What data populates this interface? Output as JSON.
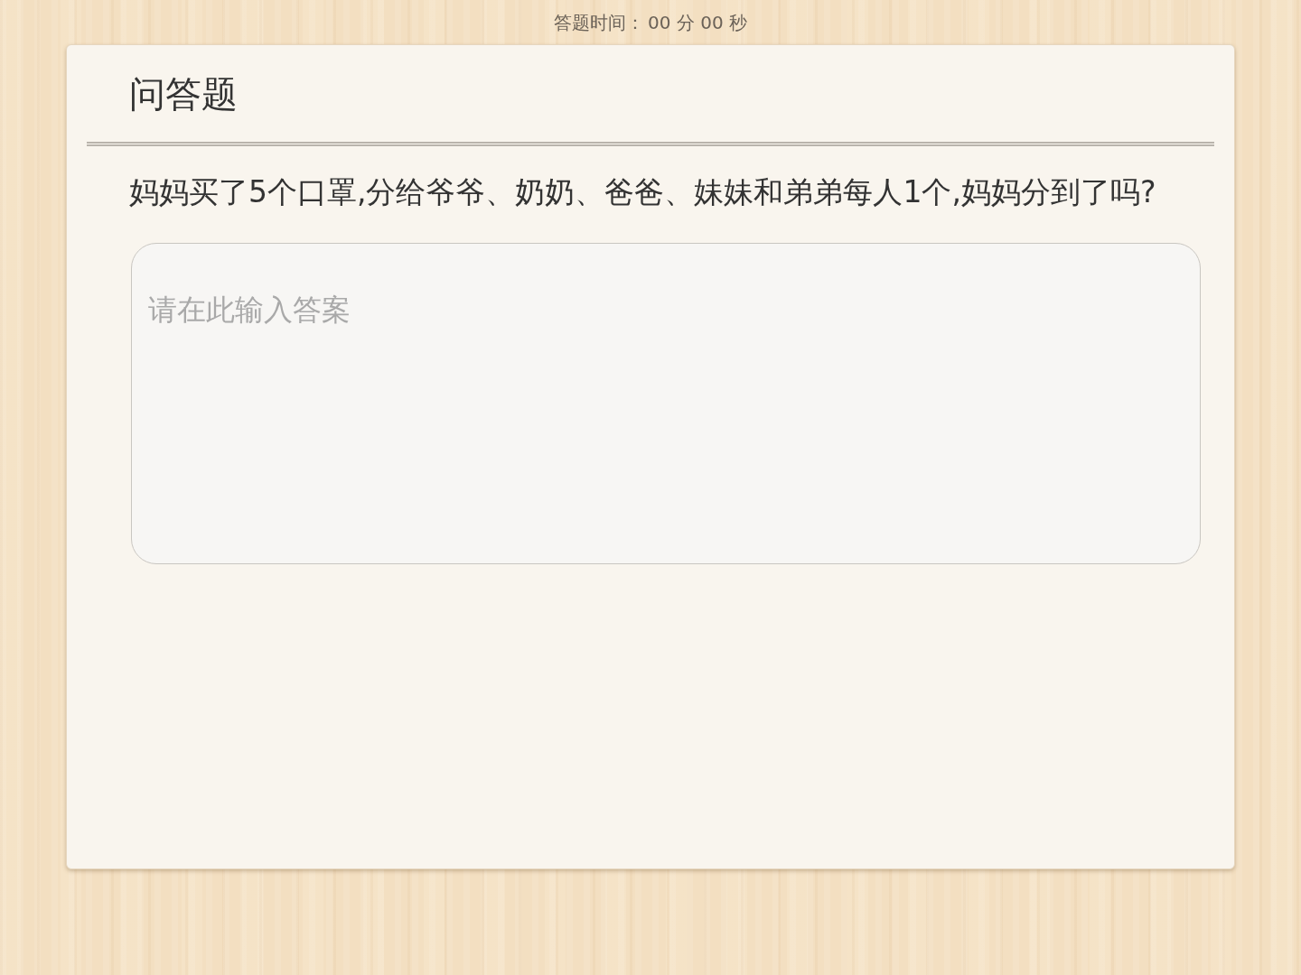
{
  "timer": {
    "label": "答题时间：",
    "value": "00 分 00 秒"
  },
  "card": {
    "title": "问答题",
    "question": "妈妈买了5个口罩,分给爷爷、奶奶、爸爸、妹妹和弟弟每人1个,妈妈分到了吗?",
    "answer": {
      "placeholder": "请在此输入答案"
    }
  }
}
